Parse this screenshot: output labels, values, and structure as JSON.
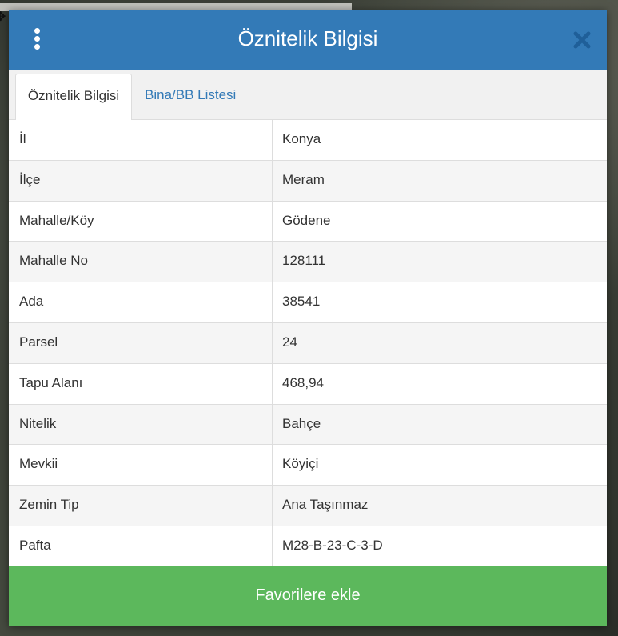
{
  "dialog": {
    "title": "Öznitelik Bilgisi",
    "menu_icon": "vertical-dots-icon",
    "close_icon": "close-icon"
  },
  "tabs": [
    {
      "label": "Öznitelik Bilgisi",
      "active": true
    },
    {
      "label": "Bina/BB Listesi",
      "active": false
    }
  ],
  "rows": [
    {
      "label": "İl",
      "value": "Konya"
    },
    {
      "label": "İlçe",
      "value": "Meram"
    },
    {
      "label": "Mahalle/Köy",
      "value": "Gödene"
    },
    {
      "label": "Mahalle No",
      "value": "128111"
    },
    {
      "label": "Ada",
      "value": "38541"
    },
    {
      "label": "Parsel",
      "value": "24"
    },
    {
      "label": "Tapu Alanı",
      "value": "468,94"
    },
    {
      "label": "Nitelik",
      "value": "Bahçe"
    },
    {
      "label": "Mevkii",
      "value": "Köyiçi"
    },
    {
      "label": "Zemin Tip",
      "value": "Ana Taşınmaz"
    },
    {
      "label": "Pafta",
      "value": "M28-B-23-C-3-D"
    }
  ],
  "footer": {
    "favorite_label": "Favorilere ekle"
  },
  "colors": {
    "header": "#337ab7",
    "button": "#5cb85c",
    "link": "#337ab7"
  }
}
